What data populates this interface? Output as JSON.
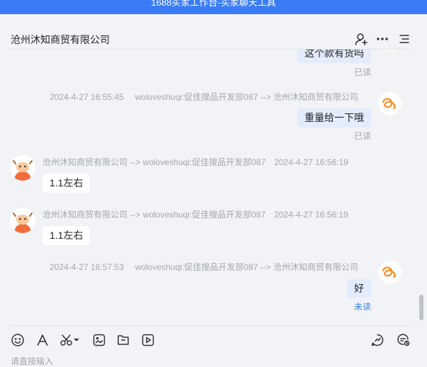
{
  "window": {
    "title": "1688买家工作台-买家聊天工具"
  },
  "header": {
    "contact_name": "沧州沐知商贸有限公司"
  },
  "messages": [
    {
      "direction": "out",
      "text": "这个款有货吗",
      "status": "已读"
    },
    {
      "direction": "out",
      "sender": "woloveshuqi:促佳搜品开发部087 --> 沧州沐知商贸有限公司",
      "time": "2024-4-27 16:55:45",
      "text": "重量给一下哦",
      "status": "已读"
    },
    {
      "direction": "in",
      "sender": "沧州沐知商贸有限公司 --> woloveshuqi:促佳搜品开发部087",
      "time": "2024-4-27 16:56:19",
      "text": "1.1左右"
    },
    {
      "direction": "in",
      "sender": "沧州沐知商贸有限公司 --> woloveshuqi:促佳搜品开发部087",
      "time": "2024-4-27 16:56:19",
      "text": "1.1左右"
    },
    {
      "direction": "out",
      "sender": "woloveshuqi:促佳搜品开发部087 --> 沧州沐知商贸有限公司",
      "time": "2024-4-27 16:57:53",
      "text": "好",
      "status": "未读"
    }
  ],
  "composer": {
    "placeholder": "请直接输入"
  },
  "colors": {
    "accent": "#3a7cf5",
    "outgoing_bubble": "#e3ecfd",
    "incoming_bubble": "#ffffff",
    "read": "#a3a7ae",
    "unread": "#3a7cf5"
  }
}
